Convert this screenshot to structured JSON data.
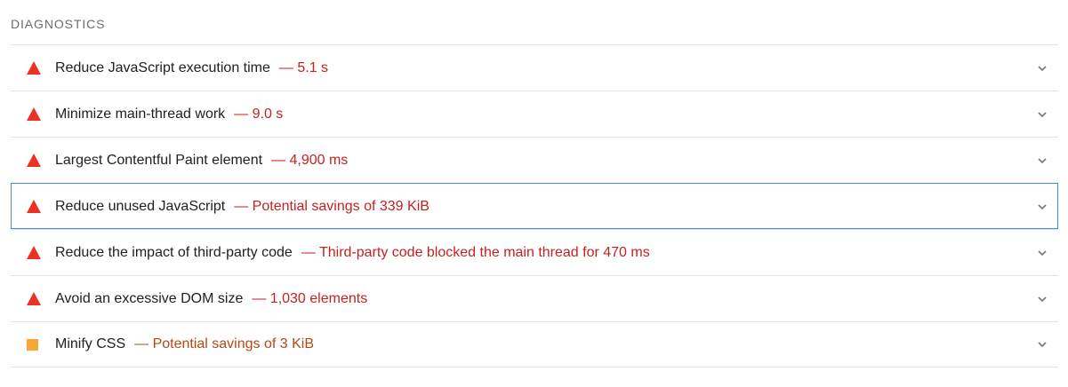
{
  "section": {
    "title": "DIAGNOSTICS"
  },
  "colors": {
    "fail": "#eb3223",
    "average": "#f7a637",
    "fail_text": "#c5221f",
    "average_text": "#b34816",
    "focus": "#4a86d8"
  },
  "audits": [
    {
      "title": "Reduce JavaScript execution time",
      "desc": "— 5.1 s",
      "status": "fail",
      "icon": "warning-triangle-icon"
    },
    {
      "title": "Minimize main-thread work",
      "desc": "— 9.0 s",
      "status": "fail",
      "icon": "warning-triangle-icon"
    },
    {
      "title": "Largest Contentful Paint element",
      "desc": "— 4,900 ms",
      "status": "fail",
      "icon": "warning-triangle-icon"
    },
    {
      "title": "Reduce unused JavaScript",
      "desc": "— Potential savings of 339 KiB",
      "status": "fail",
      "icon": "warning-triangle-icon",
      "focused": true
    },
    {
      "title": "Reduce the impact of third-party code",
      "desc": "— Third-party code blocked the main thread for 470 ms",
      "status": "fail",
      "icon": "warning-triangle-icon"
    },
    {
      "title": "Avoid an excessive DOM size",
      "desc": "— 1,030 elements",
      "status": "fail",
      "icon": "warning-triangle-icon"
    },
    {
      "title": "Minify CSS",
      "desc": "— Potential savings of 3 KiB",
      "status": "average",
      "icon": "average-square-icon"
    }
  ]
}
